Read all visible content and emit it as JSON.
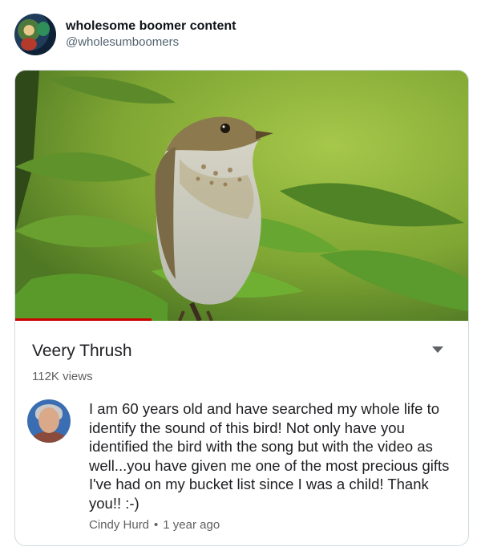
{
  "post": {
    "display_name": "wholesome boomer content",
    "handle": "@wholesumboomers"
  },
  "video": {
    "title": "Veery Thrush",
    "views": "112K views",
    "progress_fraction": 0.3
  },
  "comment": {
    "text": "I am 60 years old and have searched my whole life to identify the sound of this bird! Not only have you identified the bird with the song but with the video as well...you have given me one of the most precious gifts I've had on my bucket list since I was a child! Thank you!! :-)",
    "author": "Cindy Hurd",
    "separator": "•",
    "time": "1 year ago"
  },
  "icons": {
    "menu": "dropdown-caret-icon"
  }
}
